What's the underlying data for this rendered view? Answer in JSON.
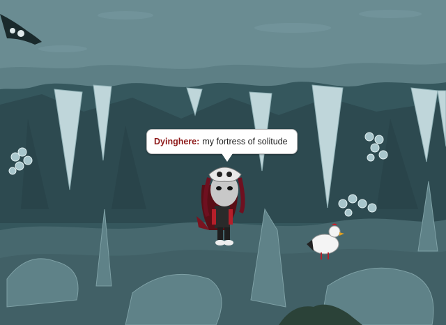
{
  "chat": {
    "speaker": "Dyinghere",
    "separator": ":",
    "message": "my fortress of solitude"
  },
  "colors": {
    "cave_wall": "#35575d",
    "cave_ceiling": "#5a7c82",
    "ice": "#c8dde0",
    "floor": "#47686e",
    "speaker_name": "#8e1a1a"
  },
  "icons": {
    "avatar": "player-avatar-skull-hat",
    "pet": "white-chicken",
    "crystals": "ice-crystal-cluster"
  }
}
